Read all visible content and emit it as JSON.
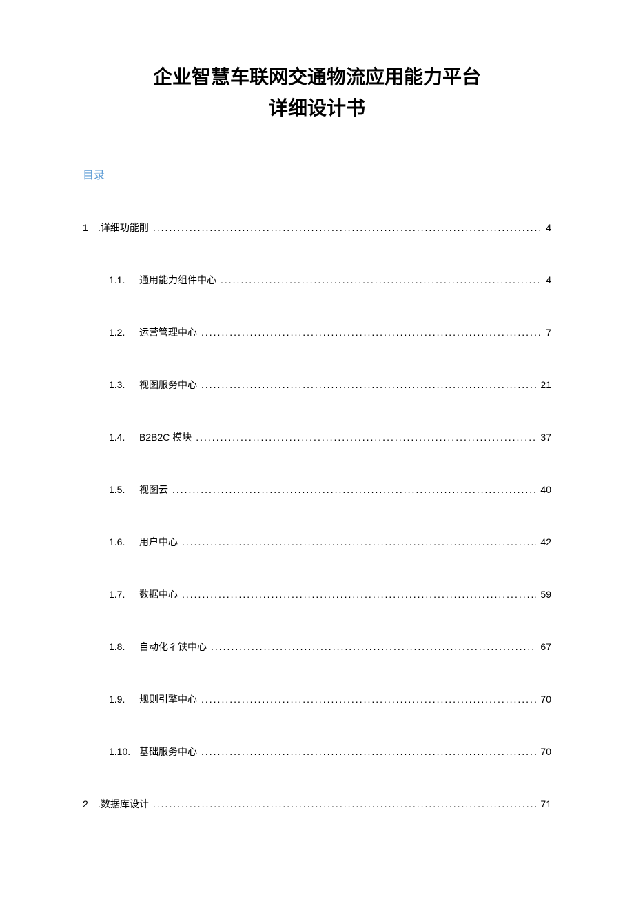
{
  "title": {
    "line1": "企业智慧车联网交通物流应用能力平台",
    "line2": "详细设计书"
  },
  "toc_heading": "目录",
  "toc": [
    {
      "level": 1,
      "num": "1",
      "prefix": ".",
      "title": "详细功能削",
      "page": "4"
    },
    {
      "level": 2,
      "num": "1.1.",
      "prefix": "",
      "title": "通用能力组件中心",
      "page": "4"
    },
    {
      "level": 2,
      "num": "1.2.",
      "prefix": "",
      "title": "运营管理中心",
      "page": "7"
    },
    {
      "level": 2,
      "num": "1.3.",
      "prefix": "",
      "title": "视图服务中心",
      "page": "21"
    },
    {
      "level": 2,
      "num": "1.4.",
      "prefix": "",
      "title": "B2B2C 模块",
      "page": "37"
    },
    {
      "level": 2,
      "num": "1.5.",
      "prefix": "",
      "title": "视图云",
      "page": "40"
    },
    {
      "level": 2,
      "num": "1.6.",
      "prefix": "",
      "title": "用户中心",
      "page": "42"
    },
    {
      "level": 2,
      "num": "1.7.",
      "prefix": "",
      "title": "数据中心",
      "page": "59"
    },
    {
      "level": 2,
      "num": "1.8.",
      "prefix": "",
      "title": "自动化彳铁中心",
      "page": "67"
    },
    {
      "level": 2,
      "num": "1.9.",
      "prefix": "",
      "title": "规则引擎中心",
      "page": "70"
    },
    {
      "level": 2,
      "num": "1.10.",
      "prefix": "",
      "title": "基础服务中心",
      "page": "70"
    },
    {
      "level": 1,
      "num": "2",
      "prefix": ".",
      "title": "数据库设计",
      "page": "71"
    }
  ]
}
